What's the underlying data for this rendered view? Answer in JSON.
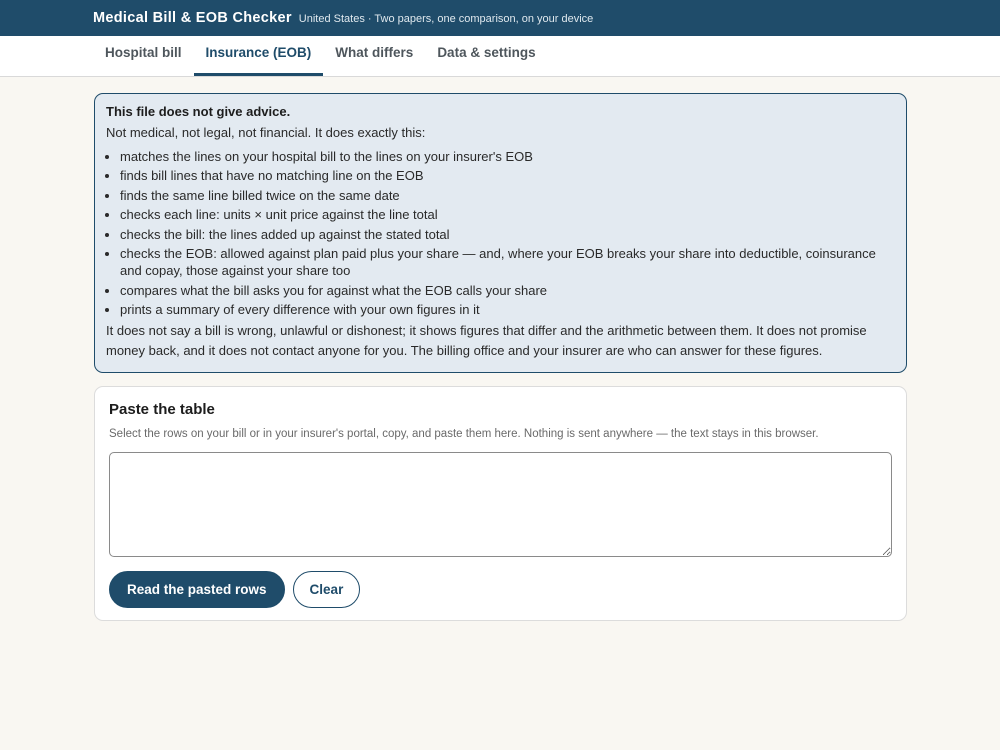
{
  "header": {
    "title": "Medical Bill & EOB Checker",
    "subtitle": "United States · Two papers, one comparison, on your device"
  },
  "tabs": [
    {
      "label": "Hospital bill",
      "active": false
    },
    {
      "label": "Insurance (EOB)",
      "active": true
    },
    {
      "label": "What differs",
      "active": false
    },
    {
      "label": "Data & settings",
      "active": false
    }
  ],
  "notice": {
    "title": "This file does not give advice.",
    "intro": "Not medical, not legal, not financial. It does exactly this:",
    "items": [
      "matches the lines on your hospital bill to the lines on your insurer's EOB",
      "finds bill lines that have no matching line on the EOB",
      "finds the same line billed twice on the same date",
      "checks each line: units × unit price against the line total",
      "checks the bill: the lines added up against the stated total",
      "checks the EOB: allowed against plan paid plus your share — and, where your EOB breaks your share into deductible, coinsurance and copay, those against your share too",
      "compares what the bill asks you for against what the EOB calls your share",
      "prints a summary of every difference with your own figures in it"
    ],
    "outro": "It does not say a bill is wrong, unlawful or dishonest; it shows figures that differ and the arithmetic between them. It does not promise money back, and it does not contact anyone for you. The billing office and your insurer are who can answer for these figures."
  },
  "paste": {
    "heading": "Paste the table",
    "help": "Select the rows on your bill or in your insurer's portal, copy, and paste them here. Nothing is sent anywhere — the text stays in this browser.",
    "value": "",
    "placeholder": "",
    "read_label": "Read the pasted rows",
    "clear_label": "Clear"
  },
  "colors": {
    "brand": "#1f4c6a",
    "notice_bg": "#e3eaf1",
    "page_bg": "#f9f7f2"
  }
}
